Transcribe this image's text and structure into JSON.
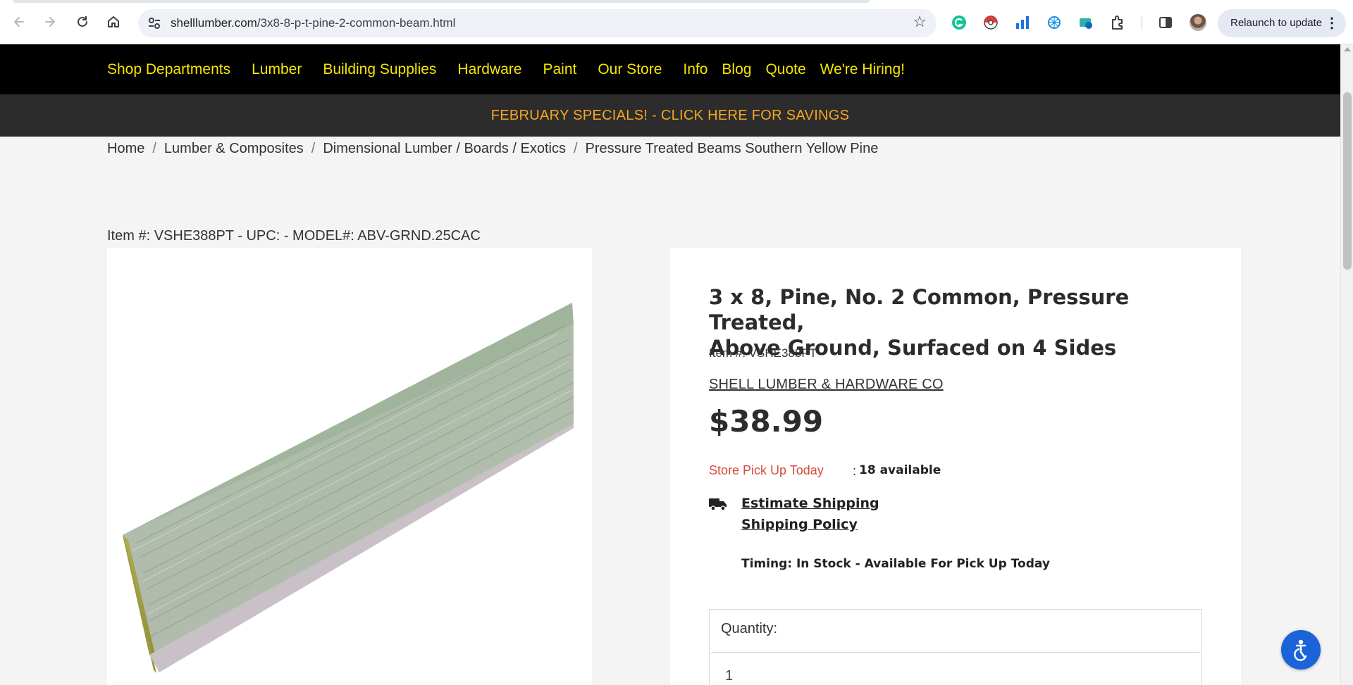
{
  "browser": {
    "url_domain": "shelllumber.com",
    "url_path": "/3x8-8-p-t-pine-2-common-beam.html",
    "relaunch_label": "Relaunch to update",
    "back_icon": "arrow-left-icon",
    "forward_icon": "arrow-right-icon",
    "reload_icon": "reload-icon",
    "home_icon": "home-icon",
    "bookmark_icon": "star-icon"
  },
  "nav": {
    "items": [
      "Shop Departments",
      "Lumber",
      "Building Supplies",
      "Hardware",
      "Paint",
      "Our Store",
      "Info",
      "Blog",
      "Quote",
      "We're Hiring!"
    ]
  },
  "promo": {
    "text": "FEBRUARY SPECIALS! - CLICK HERE FOR SAVINGS"
  },
  "breadcrumb": {
    "items": [
      "Home",
      "Lumber & Composites",
      "Dimensional Lumber / Boards / Exotics",
      "Pressure Treated Beams Southern Yellow Pine"
    ],
    "separator": "/"
  },
  "item_line": "Item #: VSHE388PT - UPC: - MODEL#: ABV-GRND.25CAC",
  "product": {
    "title_line1": "3 x 8, Pine, No. 2 Common, Pressure Treated,",
    "title_line2": "Above Ground, Surfaced on 4 Sides",
    "sku": "Item #: VSHE388PT",
    "brand": "SHELL LUMBER & HARDWARE CO",
    "price": "$38.99",
    "pickup_label": "Store Pick Up Today",
    "pickup_colon": ":",
    "pickup_available": "18 available",
    "estimate_shipping": "Estimate Shipping",
    "shipping_policy": "Shipping Policy",
    "timing": "Timing: In Stock - Available For Pick Up Today",
    "quantity_label": "Quantity:",
    "quantity_value": "1"
  },
  "colors": {
    "nav_bg": "#000000",
    "nav_text": "#f5e600",
    "promo_bg": "#2c2c2c",
    "promo_text": "#f5a623",
    "pickup_red": "#d64a3a",
    "a11y_blue": "#1a63d8"
  }
}
